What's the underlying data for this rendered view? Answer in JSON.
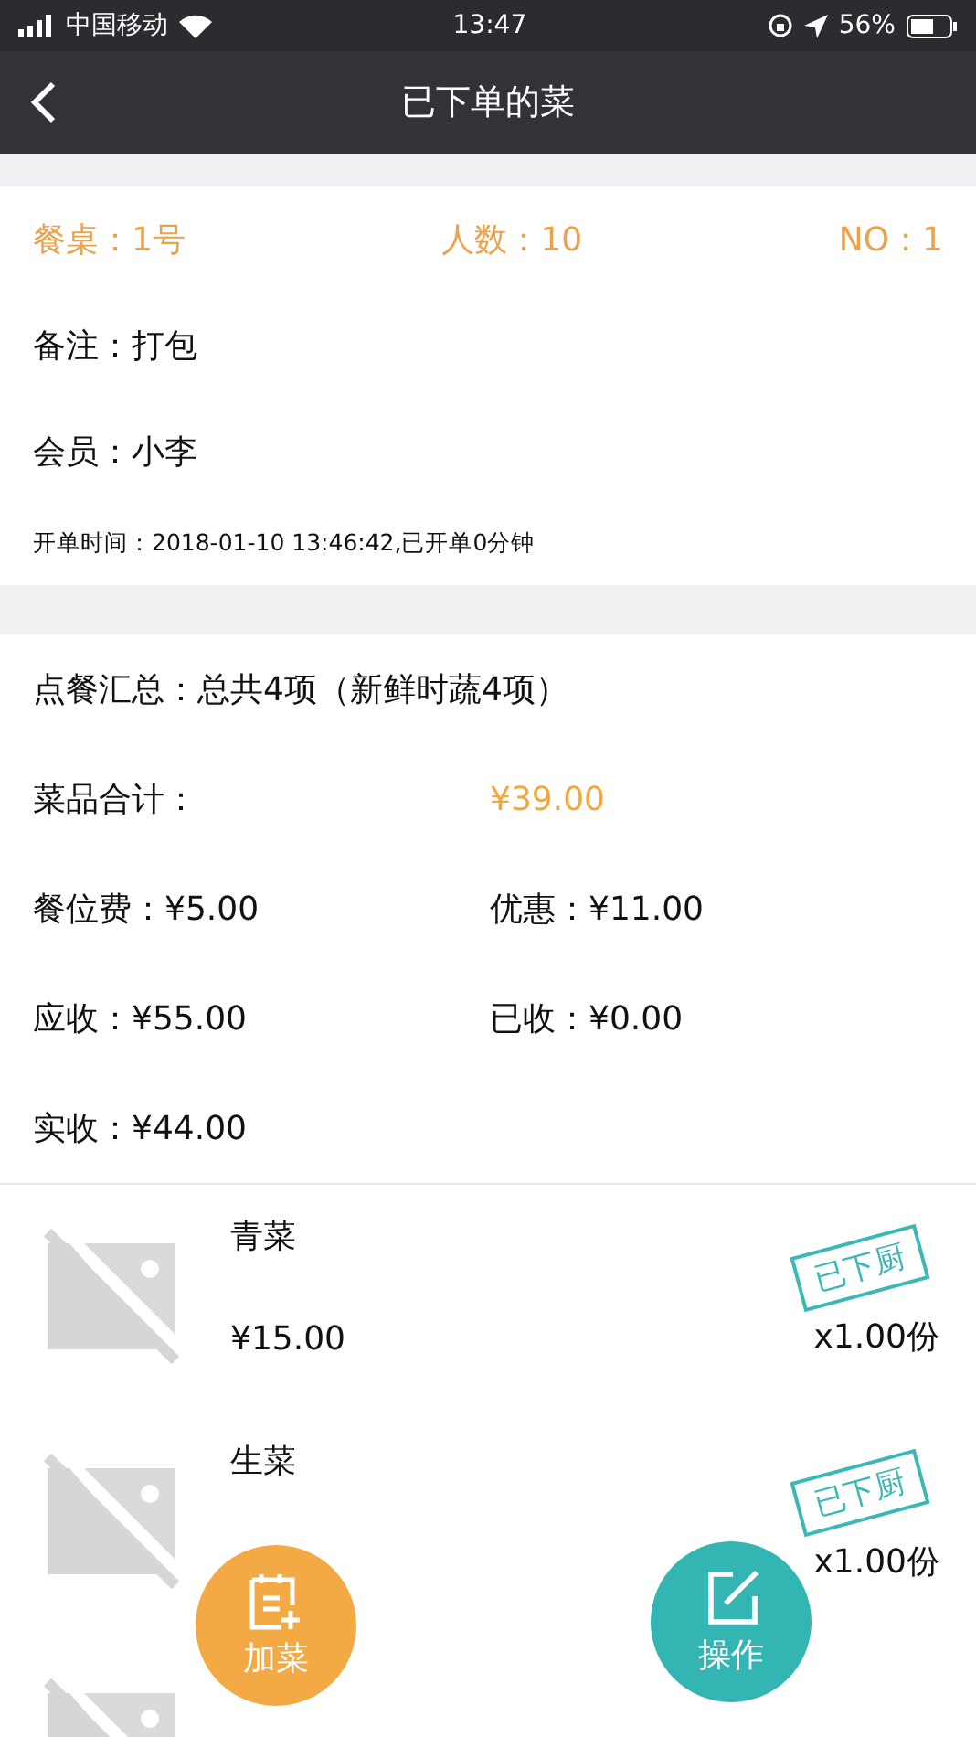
{
  "status_bar": {
    "carrier": "中国移动",
    "time": "13:47",
    "battery": "56%"
  },
  "nav": {
    "title": "已下单的菜"
  },
  "order": {
    "table": "餐桌：1号",
    "guests": "人数：10",
    "number": "NO：1",
    "note": "备注：打包",
    "member": "会员：小李",
    "opened": "开单时间：2018-01-10 13:46:42,已开单0分钟"
  },
  "summary": {
    "total": "点餐汇总：总共4项（新鲜时蔬4项）",
    "rows": [
      [
        {
          "text": "菜品合计：",
          "highlight": false
        },
        {
          "text": "¥39.00",
          "highlight": true
        }
      ],
      [
        {
          "text": "餐位费：¥5.00",
          "highlight": false
        },
        {
          "text": "优惠：¥11.00",
          "highlight": false
        }
      ],
      [
        {
          "text": "应收：¥55.00",
          "highlight": false
        },
        {
          "text": "已收：¥0.00",
          "highlight": false
        }
      ],
      [
        {
          "text": "实收：¥44.00",
          "highlight": false
        }
      ]
    ]
  },
  "dishes": [
    {
      "kind": "dish",
      "name": "青菜",
      "price": "¥15.00",
      "quantity": "x1.00份",
      "stamp": "已下厨"
    },
    {
      "kind": "dish",
      "name": "生菜",
      "quantity": "x1.00份",
      "stamp": "已下厨"
    },
    {
      "kind": "dish"
    }
  ],
  "actions": [
    {
      "label": "加菜",
      "kind": "add"
    },
    {
      "label": "操作",
      "kind": "edit"
    }
  ]
}
